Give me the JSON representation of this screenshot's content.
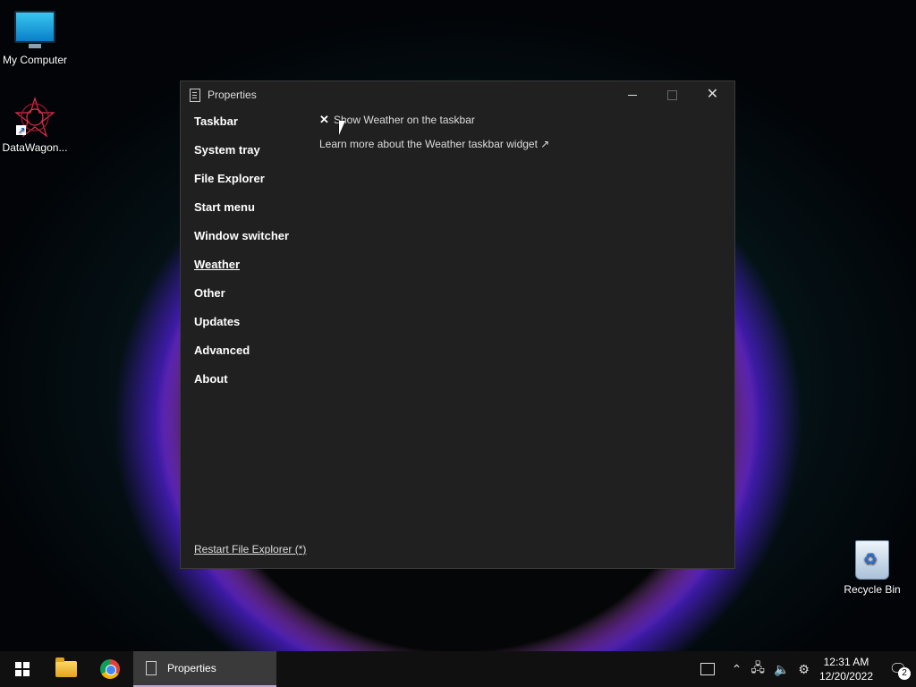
{
  "desktop": {
    "icons": [
      {
        "label": "My Computer"
      },
      {
        "label": "DataWagon..."
      },
      {
        "label": "Recycle Bin"
      }
    ]
  },
  "window": {
    "title": "Properties",
    "nav": [
      "Taskbar",
      "System tray",
      "File Explorer",
      "Start menu",
      "Window switcher",
      "Weather",
      "Other",
      "Updates",
      "Advanced",
      "About"
    ],
    "active_nav": "Weather",
    "option": {
      "mark": "✕",
      "label": "Show Weather on the taskbar"
    },
    "learn_more": "Learn more about the Weather taskbar widget ↗",
    "restart": "Restart File Explorer (*)"
  },
  "taskbar": {
    "app_label": "Properties",
    "time": "12:31 AM",
    "date": "12/20/2022",
    "notification_count": "2"
  },
  "colors": {
    "window_bg": "#202020",
    "taskbar_bg": "#101010",
    "text": "#ffffff"
  }
}
